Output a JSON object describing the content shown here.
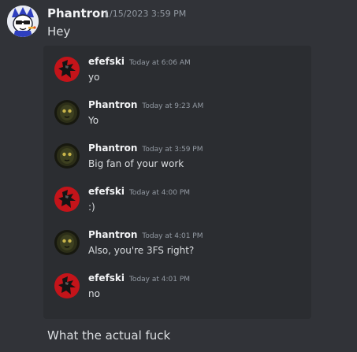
{
  "header_message": {
    "author": "Phantron",
    "timestamp": "1/15/2023 3:59 PM",
    "text": "Hey"
  },
  "embedded_messages": [
    {
      "author": "efefski",
      "timestamp": "Today at 6:06 AM",
      "text": "yo",
      "avatar": "red-black-avatar"
    },
    {
      "author": "Phantron",
      "timestamp": "Today at 9:23 AM",
      "text": "Yo",
      "avatar": "dark-green-avatar"
    },
    {
      "author": "Phantron",
      "timestamp": "Today at 3:59 PM",
      "text": "Big fan of your work",
      "avatar": "dark-green-avatar"
    },
    {
      "author": "efefski",
      "timestamp": "Today at 4:00 PM",
      "text": ":)",
      "avatar": "red-black-avatar"
    },
    {
      "author": "Phantron",
      "timestamp": "Today at 4:01 PM",
      "text": "Also, you're 3FS right?",
      "avatar": "dark-green-avatar"
    },
    {
      "author": "efefski",
      "timestamp": "Today at 4:01 PM",
      "text": "no",
      "avatar": "red-black-avatar"
    }
  ],
  "footer_message": {
    "text": "What the actual fuck"
  },
  "colors": {
    "background": "#313338",
    "embed_background": "#2b2d31",
    "author": "#f2f3f5",
    "timestamp": "#949ba4",
    "text": "#dbdee1"
  }
}
